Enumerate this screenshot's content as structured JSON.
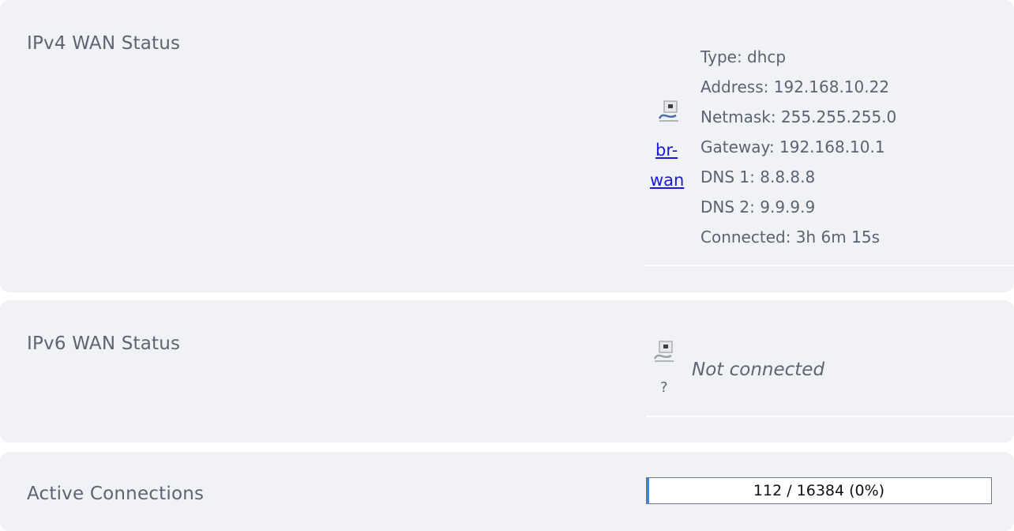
{
  "ipv4": {
    "label": "IPv4 WAN Status",
    "interface_icon": "network-interface-icon",
    "interface_link_line1": "br-",
    "interface_link_line2": "wan",
    "type": "Type: dhcp",
    "address": "Address: 192.168.10.22",
    "netmask": "Netmask: 255.255.255.0",
    "gateway": "Gateway: 192.168.10.1",
    "dns1": "DNS 1: 8.8.8.8",
    "dns2": "DNS 2: 9.9.9.9",
    "connected": "Connected: 3h 6m 15s"
  },
  "ipv6": {
    "label": "IPv6 WAN Status",
    "interface_icon": "network-interface-icon",
    "interface_name": "?",
    "status": "Not connected"
  },
  "connections": {
    "label": "Active Connections",
    "progress_text": "112 / 16384 (0%)",
    "progress_fraction": 0.0068
  },
  "colors": {
    "panel_bg": "#f1f2f5",
    "link": "#1a1ad8",
    "text": "#5a6470"
  }
}
